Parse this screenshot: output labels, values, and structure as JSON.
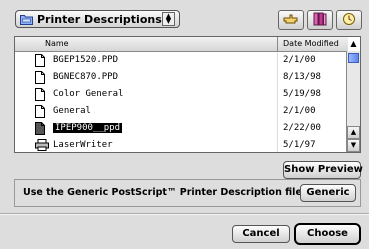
{
  "folder_popup": {
    "label": "Printer Descriptions",
    "icon": "folder-icon"
  },
  "toolbar": {
    "icons": [
      "pointing-hand-icon",
      "bookmarks-icon",
      "clock-icon"
    ]
  },
  "list": {
    "columns": {
      "name": "Name",
      "date": "Date Modified"
    },
    "rows": [
      {
        "name": "BGEP1520.PPD",
        "date": "2/1/00",
        "icon": "document-icon"
      },
      {
        "name": "BGNEC870.PPD",
        "date": "8/13/98",
        "icon": "document-icon"
      },
      {
        "name": "Color General",
        "date": "5/19/98",
        "icon": "document-icon"
      },
      {
        "name": "General",
        "date": "2/1/00",
        "icon": "document-icon"
      },
      {
        "name": "IPEP900__ppd",
        "date": "2/22/00",
        "icon": "document-icon",
        "selected": true
      },
      {
        "name": "LaserWriter",
        "date": "5/1/97",
        "icon": "printer-icon"
      }
    ]
  },
  "show_preview_label": "Show Preview",
  "generic": {
    "message": "Use the Generic PostScript™ Printer Description file:",
    "button_label": "Generic"
  },
  "footer": {
    "cancel_label": "Cancel",
    "choose_label": "Choose"
  },
  "colors": {
    "selection": "#000000",
    "scroll_thumb": "#5f87ef"
  }
}
